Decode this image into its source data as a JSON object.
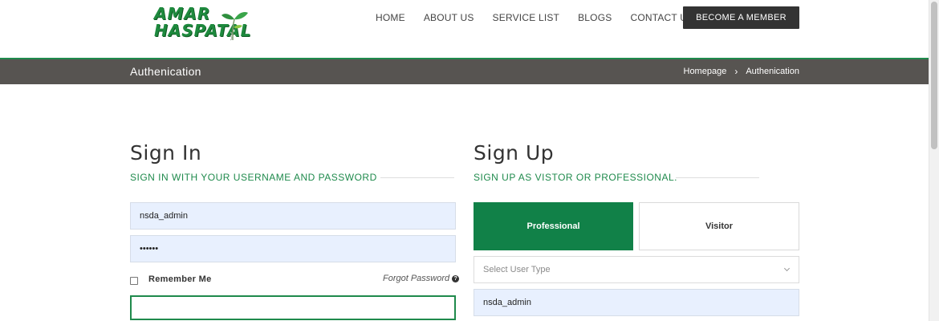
{
  "header": {
    "logo": {
      "line1": "AMAR",
      "line2": "HASPATAL"
    },
    "nav": [
      "HOME",
      "ABOUT US",
      "SERVICE LIST",
      "BLOGS",
      "CONTACT US"
    ],
    "member_button": "BECOME A MEMBER"
  },
  "titlebar": {
    "title": "Authenication",
    "breadcrumb": {
      "home": "Homepage",
      "separator": "›",
      "current": "Authenication"
    }
  },
  "signin": {
    "heading": "Sign In",
    "subheading": "SIGN IN WITH YOUR USERNAME AND PASSWORD",
    "username_value": "nsda_admin",
    "password_value": "••••••",
    "remember_label": "Remember Me",
    "forgot_label": "Forgot Password",
    "help_glyph": "?"
  },
  "signup": {
    "heading": "Sign Up",
    "subheading": "SIGN UP AS VISTOR OR PROFESSIONAL.",
    "tabs": [
      "Professional",
      "Visitor"
    ],
    "select_placeholder": "Select User Type",
    "username_value": "nsda_admin"
  },
  "colors": {
    "brand_green": "#1f8a4c",
    "active_tab": "#118148",
    "titlebar": "#575451",
    "input_autofill": "#e8f0fe"
  }
}
